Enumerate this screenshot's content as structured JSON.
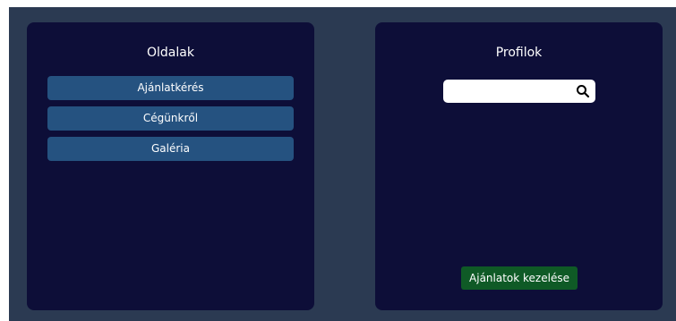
{
  "pages_panel": {
    "title": "Oldalak",
    "items": [
      {
        "label": "Ajánlatkérés"
      },
      {
        "label": "Cégünkről"
      },
      {
        "label": "Galéria"
      }
    ]
  },
  "profiles_panel": {
    "title": "Profilok",
    "search": {
      "value": "",
      "placeholder": "",
      "icon": "search-icon"
    },
    "manage_button_label": "Ajánlatok kezelése"
  },
  "colors": {
    "background": "#2b3a52",
    "panel": "#0d0e38",
    "page_button": "#255280",
    "manage_button": "#0f5a26"
  }
}
